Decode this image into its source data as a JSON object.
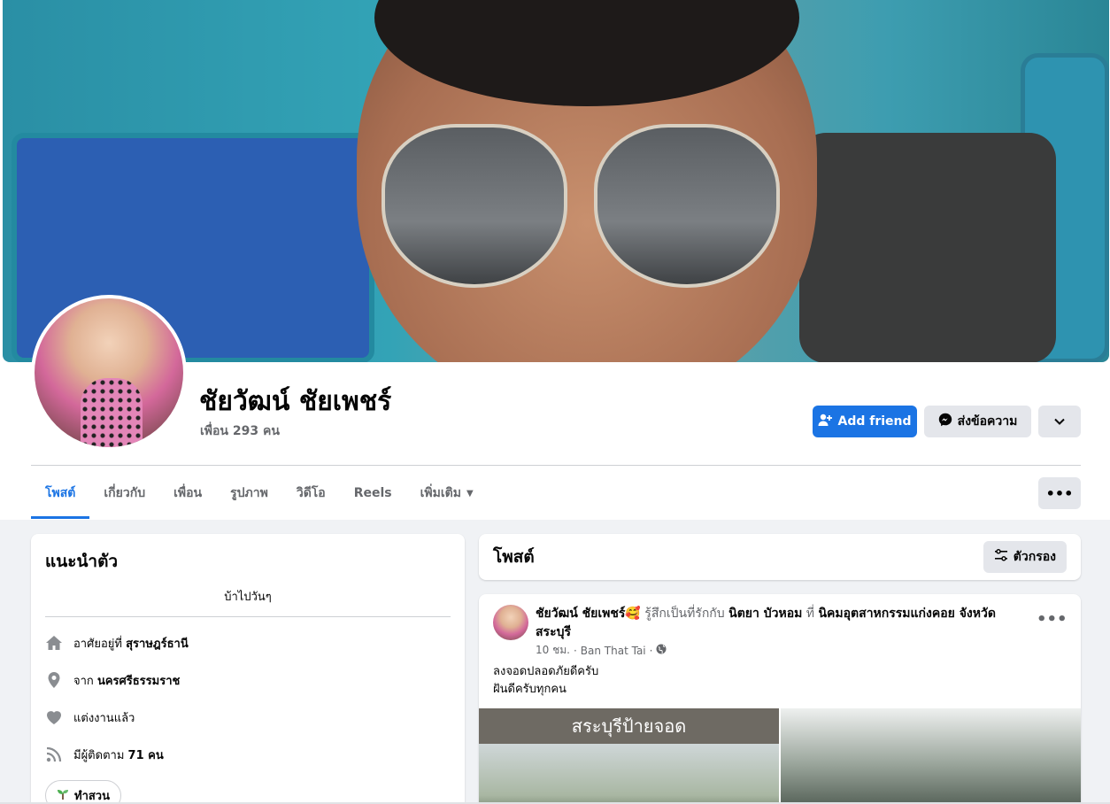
{
  "profile": {
    "name": "ชัยวัฒน์ ชัยเพชร์",
    "friends_count": "เพื่อน 293 คน"
  },
  "actions": {
    "add_friend": "Add friend",
    "message": "ส่งข้อความ"
  },
  "tabs": [
    {
      "label": "โพสต์"
    },
    {
      "label": "เกี่ยวกับ"
    },
    {
      "label": "เพื่อน"
    },
    {
      "label": "รูปภาพ"
    },
    {
      "label": "วิดีโอ"
    },
    {
      "label": "Reels"
    },
    {
      "label": "เพิ่มเติม"
    }
  ],
  "intro": {
    "title": "แนะนำตัว",
    "bio": "บ้าไปวันๆ",
    "lives_prefix": "อาศัยอยู่ที่",
    "lives_value": "สุราษฎร์ธานี",
    "from_prefix": "จาก",
    "from_value": "นครศรีธรรมราช",
    "relationship": "แต่งงานแล้ว",
    "followers_prefix": "มีผู้ติดตาม",
    "followers_value": "71 คน",
    "hobby": "ทำสวน"
  },
  "posts": {
    "title": "โพสต์",
    "filter_label": "ตัวกรอง"
  },
  "post": {
    "author": "ชัยวัฒน์ ชัยเพชร์",
    "feeling": "รู้สึกเป็นที่รักกับ",
    "tagged": "นิตยา บัวหอม",
    "at": "ที่",
    "place": "นิคมอุตสาหกรรมแก่งคอย จังหวัดสระบุรี",
    "time": "10 ชม.",
    "location": "Ban That Tai",
    "text_line1": "ลงจอดปลอดภัยดีครับ",
    "text_line2": "ฝันดีครับทุกคน",
    "photo_caption": "สระบุรีป้ายจอด"
  },
  "colors": {
    "accent": "#1b74e4",
    "button_gray": "#e4e6eb",
    "page_bg": "#f0f2f5"
  }
}
